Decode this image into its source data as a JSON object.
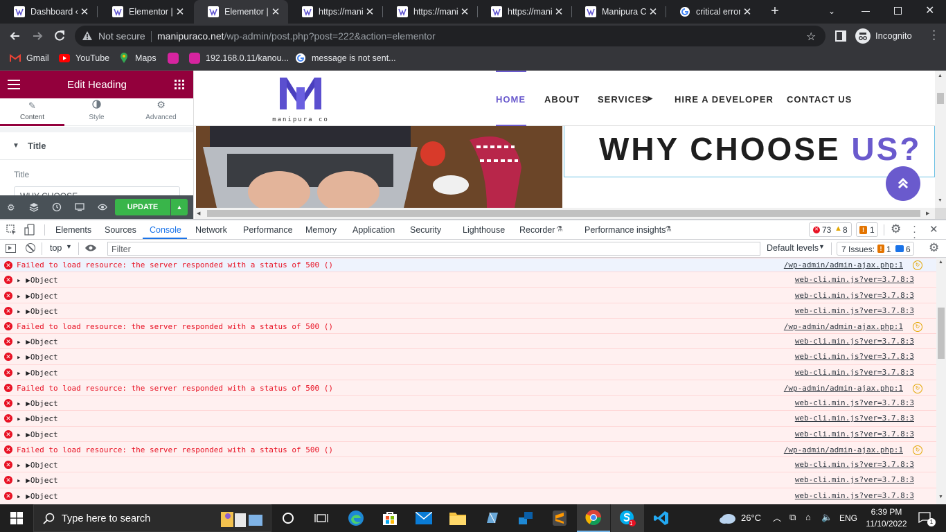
{
  "browser": {
    "tabs": [
      {
        "title": "Dashboard ‹",
        "favicon": "wordpress-icon"
      },
      {
        "title": "Elementor | H",
        "favicon": "manipura-icon"
      },
      {
        "title": "Elementor | H",
        "favicon": "manipura-icon",
        "active": true
      },
      {
        "title": "https://manip",
        "favicon": "manipura-icon"
      },
      {
        "title": "https://manip",
        "favicon": "manipura-icon"
      },
      {
        "title": "https://manip",
        "favicon": "manipura-icon"
      },
      {
        "title": "Manipura Co",
        "favicon": "manipura-icon"
      },
      {
        "title": "critical error i",
        "favicon": "google-icon"
      }
    ],
    "security_label": "Not secure",
    "url_host": "manipuraco.net",
    "url_path": "/wp-admin/post.php?post=222&action=elementor",
    "profile_label": "Incognito",
    "bookmarks": [
      {
        "label": "Gmail",
        "icon": "gmail-icon"
      },
      {
        "label": "YouTube",
        "icon": "youtube-icon"
      },
      {
        "label": "Maps",
        "icon": "maps-icon"
      },
      {
        "label": "",
        "icon": "app-icon"
      },
      {
        "label": "192.168.0.11/kanou...",
        "icon": "app-icon"
      },
      {
        "label": "message is not sent...",
        "icon": "google-icon"
      }
    ]
  },
  "elementor": {
    "panel_title": "Edit Heading",
    "tabs": [
      "Content",
      "Style",
      "Advanced"
    ],
    "section_title": "Title",
    "field_label": "Title",
    "field_value": "WHY CHOOSE",
    "update_label": "UPDATE",
    "accent_color": "#93003c"
  },
  "site": {
    "logo_text": "manipura co",
    "nav": [
      "HOME",
      "ABOUT",
      "SERVICES",
      "HIRE A DEVELOPER",
      "CONTACT US"
    ],
    "heading_main": "WHY CHOOSE",
    "heading_accent": "US?",
    "accent_color": "#6a5acd"
  },
  "devtools": {
    "tabs": [
      "Elements",
      "Sources",
      "Console",
      "Network",
      "Performance",
      "Memory",
      "Application",
      "Security",
      "Lighthouse",
      "Recorder",
      "Performance insights"
    ],
    "active_tab": "Console",
    "error_count": "73",
    "warning_count": "8",
    "issue_badge_count": "1",
    "context": "top",
    "filter_placeholder": "Filter",
    "levels_label": "Default levels",
    "issues_label": "7 Issues:",
    "issues_warn": "1",
    "issues_info": "6",
    "console": [
      {
        "type": "error",
        "text": "Failed to load resource: the server responded with a status of 500 ()",
        "source": "/wp-admin/admin-ajax.php:1"
      },
      {
        "type": "object",
        "text": "Object",
        "source": "web-cli.min.js?ver=3.7.8:3"
      },
      {
        "type": "object",
        "text": "Object",
        "source": "web-cli.min.js?ver=3.7.8:3"
      },
      {
        "type": "object",
        "text": "Object",
        "source": "web-cli.min.js?ver=3.7.8:3"
      },
      {
        "type": "error",
        "text": "Failed to load resource: the server responded with a status of 500 ()",
        "source": "/wp-admin/admin-ajax.php:1"
      },
      {
        "type": "object",
        "text": "Object",
        "source": "web-cli.min.js?ver=3.7.8:3"
      },
      {
        "type": "object",
        "text": "Object",
        "source": "web-cli.min.js?ver=3.7.8:3"
      },
      {
        "type": "object",
        "text": "Object",
        "source": "web-cli.min.js?ver=3.7.8:3"
      },
      {
        "type": "error",
        "text": "Failed to load resource: the server responded with a status of 500 ()",
        "source": "/wp-admin/admin-ajax.php:1"
      },
      {
        "type": "object",
        "text": "Object",
        "source": "web-cli.min.js?ver=3.7.8:3"
      },
      {
        "type": "object",
        "text": "Object",
        "source": "web-cli.min.js?ver=3.7.8:3"
      },
      {
        "type": "object",
        "text": "Object",
        "source": "web-cli.min.js?ver=3.7.8:3"
      },
      {
        "type": "error",
        "text": "Failed to load resource: the server responded with a status of 500 ()",
        "source": "/wp-admin/admin-ajax.php:1"
      },
      {
        "type": "object",
        "text": "Object",
        "source": "web-cli.min.js?ver=3.7.8:3"
      },
      {
        "type": "object",
        "text": "Object",
        "source": "web-cli.min.js?ver=3.7.8:3"
      },
      {
        "type": "object",
        "text": "Object",
        "source": "web-cli.min.js?ver=3.7.8:3"
      }
    ]
  },
  "taskbar": {
    "search_placeholder": "Type here to search",
    "weather": "26°C",
    "language": "ENG",
    "time": "6:39 PM",
    "date": "11/10/2022",
    "notification_count": "1"
  }
}
